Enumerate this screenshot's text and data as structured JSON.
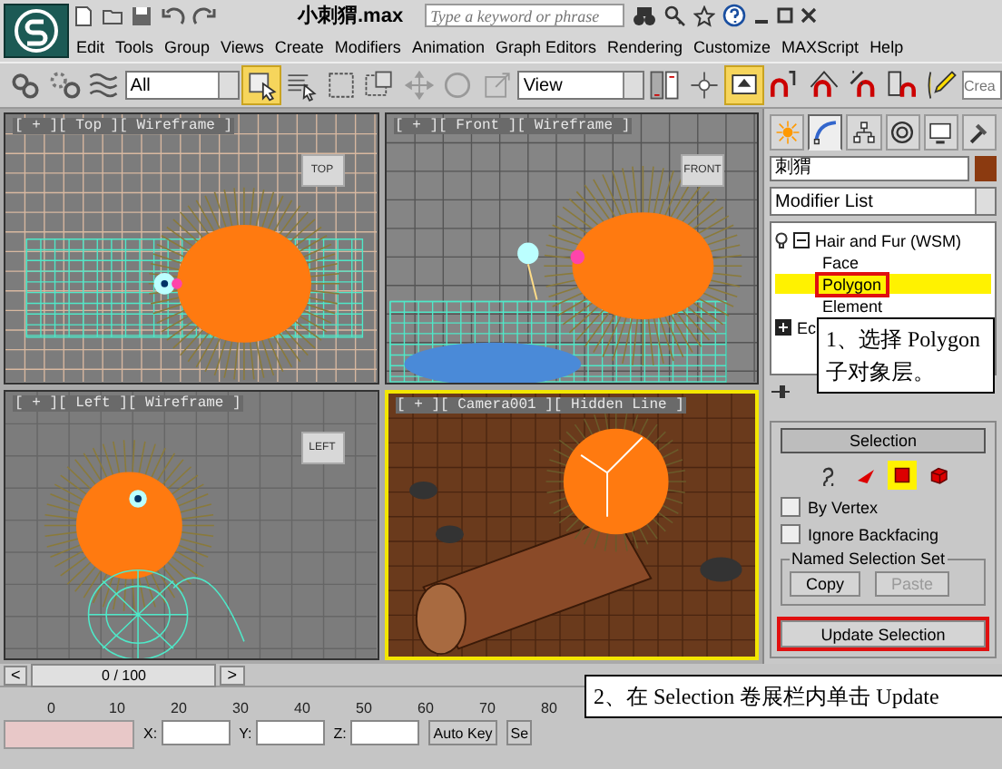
{
  "title_bar": {
    "title": "小刺猬.max",
    "search": {
      "placeholder": "Type a keyword or phrase"
    }
  },
  "menu": [
    "Edit",
    "Tools",
    "Group",
    "Views",
    "Create",
    "Modifiers",
    "Animation",
    "Graph Editors",
    "Rendering",
    "Customize",
    "MAXScript",
    "Help"
  ],
  "toolbar": [
    {
      "kind": "button",
      "selected": false
    },
    {
      "kind": "button",
      "selected": false
    },
    {
      "kind": "button",
      "selected": false
    },
    {
      "kind": "dropdown",
      "value": "All"
    },
    {
      "kind": "button",
      "selected": true
    },
    {
      "kind": "button",
      "selected": false
    },
    {
      "kind": "button",
      "selected": false
    },
    {
      "kind": "button",
      "selected": false
    },
    {
      "kind": "button",
      "selected": false
    },
    {
      "kind": "button",
      "selected": false
    },
    {
      "kind": "button",
      "selected": false
    },
    {
      "kind": "dropdown",
      "value": "View"
    },
    {
      "kind": "button",
      "selected": false
    },
    {
      "kind": "button",
      "selected": false
    },
    {
      "kind": "button",
      "selected": true
    },
    {
      "kind": "button",
      "selected": false
    },
    {
      "kind": "button",
      "selected": false
    },
    {
      "kind": "button",
      "selected": false
    },
    {
      "kind": "button",
      "selected": false
    },
    {
      "kind": "button",
      "selected": false
    },
    {
      "kind": "field",
      "placeholder": "Crea"
    }
  ],
  "viewports": [
    {
      "label": "[ + ][ Top ][ Wireframe ]",
      "kind": "top",
      "cube_label": "TOP",
      "active": false
    },
    {
      "label": "[ + ][ Front ][ Wireframe ]",
      "kind": "front",
      "cube_label": "FRONT",
      "active": false
    },
    {
      "label": "[ + ][ Left ][ Wireframe ]",
      "kind": "left",
      "cube_label": "LEFT",
      "active": false
    },
    {
      "label": "[ + ][ Camera001 ][ Hidden Line ]",
      "kind": "camera",
      "active": true
    }
  ],
  "command_panel": {
    "tabs": [
      {
        "selected": false
      },
      {
        "selected": true
      },
      {
        "selected": false
      },
      {
        "selected": false
      },
      {
        "selected": false
      },
      {
        "selected": false
      }
    ],
    "object": {
      "name": "刺猬",
      "color": "#8b3a10"
    },
    "modifier_list": "Modifier List",
    "stack": [
      {
        "label": "Hair and Fur (WSM)",
        "expanded": true,
        "children": [
          {
            "label": "Face",
            "selected": false,
            "highlighted": false
          },
          {
            "label": "Polygon",
            "selected": true,
            "highlighted": true
          },
          {
            "label": "Element",
            "selected": false,
            "highlighted": false
          }
        ]
      },
      {
        "label": "Ec",
        "expanded": false
      }
    ],
    "rollout": {
      "title": "Selection",
      "subobjects": [
        {
          "selected": false
        },
        {
          "selected": false
        },
        {
          "selected": true
        },
        {
          "selected": false
        }
      ],
      "checkboxes": [
        {
          "label": "By Vertex",
          "checked": false
        },
        {
          "label": "Ignore Backfacing",
          "checked": false
        }
      ],
      "group_title": "Named Selection Set",
      "buttons": [
        {
          "label": "Copy",
          "disabled": false
        },
        {
          "label": "Paste",
          "disabled": true
        }
      ],
      "update_button": {
        "label": "Update Selection",
        "highlighted": true
      }
    }
  },
  "time_slider": {
    "label": "0 / 100",
    "prev": "<",
    "next": ">"
  },
  "track_bar": {
    "ticks": [
      "0",
      "10",
      "20",
      "30",
      "40",
      "50",
      "60",
      "70",
      "80"
    ]
  },
  "status_bar": {
    "coords": [
      "X:",
      "Y:",
      "Z:"
    ],
    "auto_key": "Auto Key",
    "set_key": "Se"
  },
  "callouts": [
    {
      "text": "1、选择 Polygon 子对象层。"
    },
    {
      "text": "2、在 Selection 卷展栏内单击 Update"
    }
  ]
}
